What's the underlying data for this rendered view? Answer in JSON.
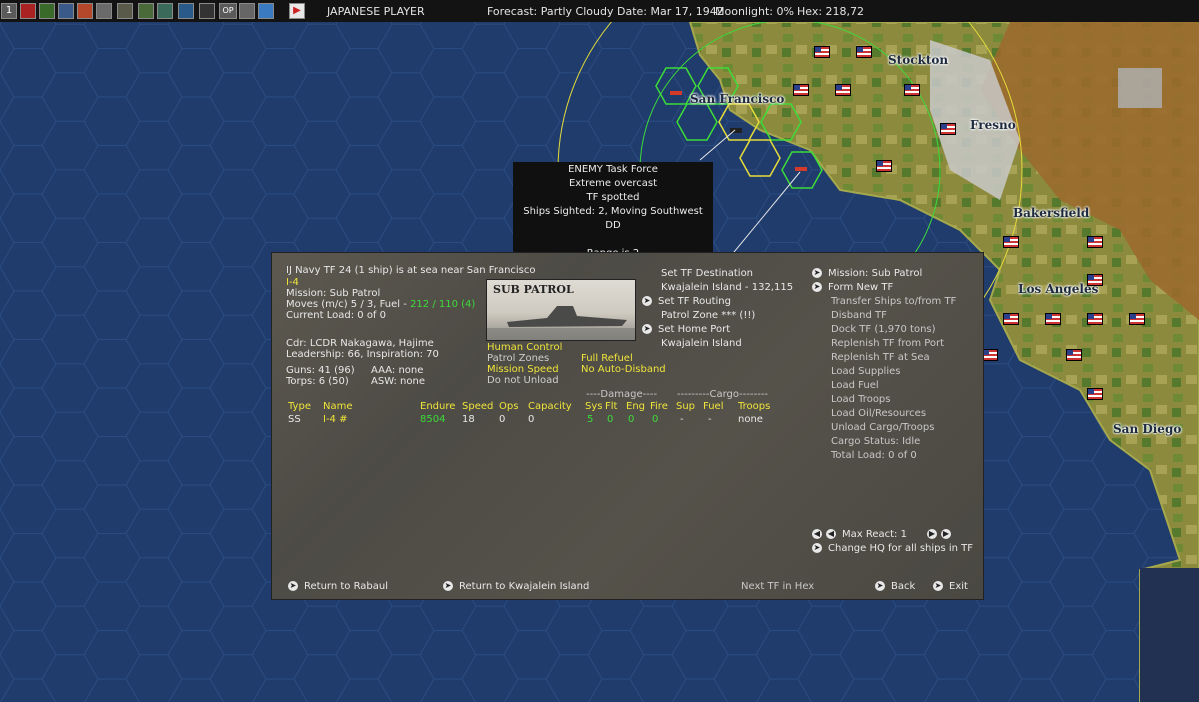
{
  "topbar": {
    "player": "JAPANESE PLAYER",
    "forecast": "Forecast: Partly Cloudy",
    "date": "Date: Mar 17, 1942",
    "moonlight": "Moonlight: 0%",
    "hex": "Hex: 218,72",
    "first_icon": "1",
    "op_icon": "OP"
  },
  "map": {
    "cities": [
      "Stockton",
      "San Francisco",
      "Fresno",
      "Bakersfield",
      "Los Angeles",
      "San Diego"
    ]
  },
  "popup": {
    "lines": [
      "ENEMY Task Force",
      "Extreme overcast",
      "TF spotted",
      "Ships Sighted: 2, Moving Southwest",
      "DD",
      "",
      "Range is 2"
    ]
  },
  "panel": {
    "header": "IJ Navy TF 24 (1 ship) is at sea near San Francisco",
    "ship_name": "I-4",
    "mission": "Mission: Sub Patrol",
    "moves": "Moves (m/c) 5 / 3, Fuel -",
    "fuel": "212 / 110 (4)",
    "load": "Current Load: 0 of 0",
    "commander": "Cdr: LCDR Nakagawa, Hajime",
    "leadership": "Leadership: 66, Inspiration: 70",
    "guns": "Guns: 41 (96)",
    "aaa": "AAA: none",
    "torps": "Torps: 6 (50)",
    "asw": "ASW: none",
    "image_caption": "SUB PATROL",
    "options": {
      "human_control": "Human Control",
      "patrol_zones": "Patrol Zones",
      "mission_speed": "Mission Speed",
      "do_not_unload": "Do not Unload",
      "full_refuel": "Full Refuel",
      "no_auto_disband": "No Auto-Disband"
    },
    "nav": {
      "set_destination": "Set TF Destination",
      "destination": "Kwajalein Island - 132,115",
      "set_routing": "Set TF Routing",
      "patrol_zone": "Patrol Zone *** (!!)",
      "set_home_port": "Set Home Port",
      "home_port": "Kwajalein Island"
    },
    "right_menu": [
      "Mission: Sub Patrol",
      "Form New TF",
      "Transfer Ships to/from TF",
      "Disband TF",
      "Dock TF (1,970 tons)",
      "Replenish TF from Port",
      "Replenish TF at Sea",
      "Load Supplies",
      "Load Fuel",
      "Load Troops",
      "Load Oil/Resources",
      "Unload Cargo/Troops",
      "Cargo Status: Idle",
      "Total Load: 0 of 0"
    ],
    "table": {
      "group_damage": "----Damage----",
      "group_cargo": "---------Cargo--------",
      "headers": [
        "Type",
        "Name",
        "Endure",
        "Speed",
        "Ops",
        "Capacity",
        "Sys",
        "Flt",
        "Eng",
        "Fire",
        "Sup",
        "Fuel",
        "Troops"
      ],
      "rows": [
        [
          "SS",
          "I-4 #",
          "8504",
          "18",
          "0",
          "0",
          "5",
          "0",
          "0",
          "0",
          "-",
          "-",
          "none"
        ]
      ]
    },
    "max_react": "Max React:  1",
    "change_hq": "Change HQ for all ships in TF",
    "footer": {
      "return_rabaul": "Return to Rabaul",
      "return_kwajalein": "Return to Kwajalein Island",
      "next_tf": "Next TF in Hex",
      "back": "Back",
      "exit": "Exit"
    }
  },
  "colors": {
    "ocean": "#1f3c6c",
    "highlight_yellow": "#f0e43a",
    "highlight_green": "#3ddc3a"
  }
}
